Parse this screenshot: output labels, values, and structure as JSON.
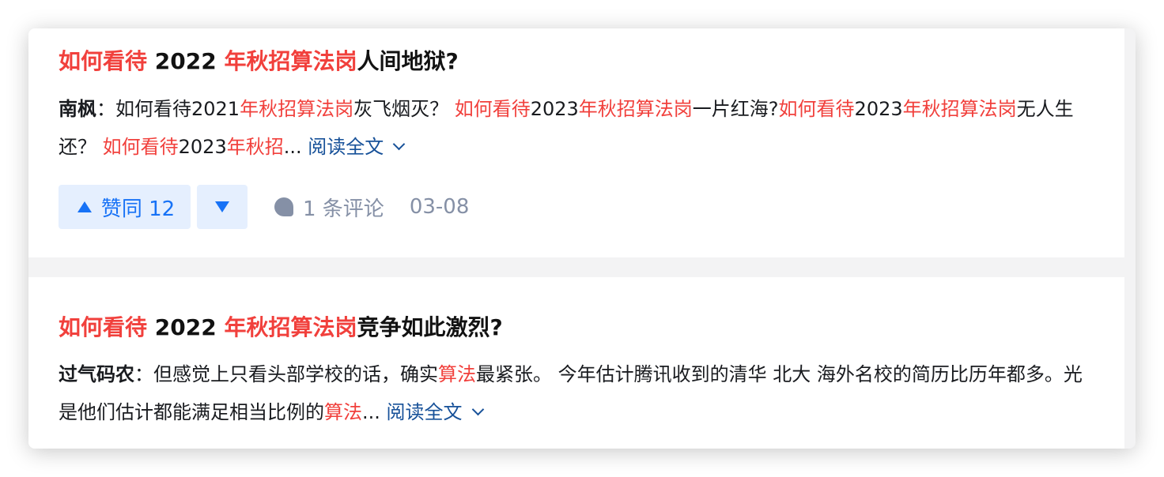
{
  "results": [
    {
      "title_parts": [
        {
          "text": "如何看待",
          "hl": true
        },
        {
          "text": " 2022 ",
          "hl": false
        },
        {
          "text": "年秋招算法岗",
          "hl": true
        },
        {
          "text": "人间地狱?",
          "hl": false
        }
      ],
      "author": "南枫",
      "author_sep": "：",
      "excerpt_parts": [
        {
          "text": "如何看待2021",
          "hl": false
        },
        {
          "text": "年秋招算法岗",
          "hl": true
        },
        {
          "text": "灰飞烟灭？ ",
          "hl": false
        },
        {
          "text": "如何看待",
          "hl": true
        },
        {
          "text": "2023",
          "hl": false
        },
        {
          "text": "年秋招算法岗",
          "hl": true
        },
        {
          "text": "一片红海?",
          "hl": false
        },
        {
          "text": "如何看待",
          "hl": true
        },
        {
          "text": "2023",
          "hl": false
        },
        {
          "text": "年秋招算法岗",
          "hl": true
        },
        {
          "text": "无人生还？ ",
          "hl": false
        },
        {
          "text": "如何看待",
          "hl": true
        },
        {
          "text": "2023",
          "hl": false
        },
        {
          "text": "年秋招",
          "hl": true
        },
        {
          "text": "...",
          "hl": false
        }
      ],
      "read_more": " 阅读全文",
      "vote_label": "赞同 12",
      "comment_label": "1 条评论",
      "date": "03-08"
    },
    {
      "title_parts": [
        {
          "text": "如何看待",
          "hl": true
        },
        {
          "text": " 2022 ",
          "hl": false
        },
        {
          "text": "年秋招算法岗",
          "hl": true
        },
        {
          "text": "竞争如此激烈?",
          "hl": false
        }
      ],
      "author": "过气码农",
      "author_sep": "：",
      "excerpt_parts": [
        {
          "text": "但感觉上只看头部学校的话，确实",
          "hl": false
        },
        {
          "text": "算法",
          "hl": true
        },
        {
          "text": "最紧张。 今年估计腾讯收到的清华 北大 海外名校的简历比历年都多。光是他们估计都能满足相当比例的",
          "hl": false
        },
        {
          "text": "算法",
          "hl": true
        },
        {
          "text": "...",
          "hl": false
        }
      ],
      "read_more": " 阅读全文"
    }
  ],
  "colors": {
    "highlight": "#f1403c",
    "link": "#175199",
    "vote": "#1772f6",
    "vote_bg": "#e5effe",
    "meta": "#8590a6"
  },
  "icons": {
    "vote_up": "triangle-up-icon",
    "vote_down": "triangle-down-icon",
    "comment": "comment-bubble-icon",
    "expand": "chevron-down-icon"
  }
}
